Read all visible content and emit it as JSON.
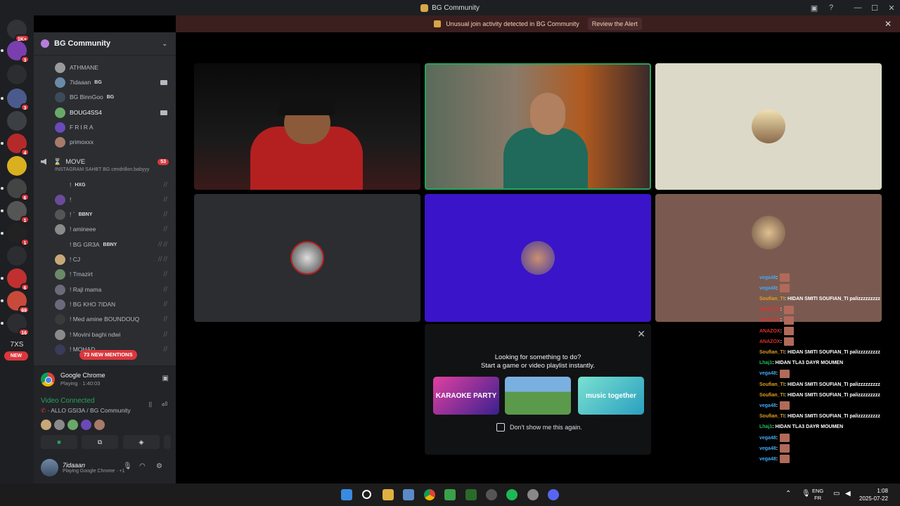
{
  "window": {
    "title": "BG Community",
    "controls": [
      "—",
      "☐",
      "✕"
    ]
  },
  "alert": {
    "message": "Unusual join activity detected in BG Community",
    "button": "Review the Alert",
    "close": "✕"
  },
  "rail": {
    "home_badge": "1K+",
    "badges": [
      "3",
      "3",
      "4",
      "6",
      "1",
      "1",
      "6",
      "69",
      "16"
    ],
    "text_7xs": "7XS",
    "new_pill": "NEW"
  },
  "sidebar": {
    "server_name": "BG Community",
    "users_top": [
      {
        "name": "ATHMANE",
        "tag": ""
      },
      {
        "name": "7idaaan",
        "tag": "BG"
      },
      {
        "name": "BG BinnGoo",
        "tag": "BG"
      },
      {
        "name": "BOUG4SS4",
        "tag": ""
      },
      {
        "name": "FRIRA",
        "tag": ""
      },
      {
        "name": "primoxxx",
        "tag": ""
      }
    ],
    "channel": {
      "name": "MOVE",
      "count": "53",
      "subtitle": "INSTAGRAM SAHBT BG cendrillon.babyyy"
    },
    "users_move": [
      {
        "name": "!",
        "tag": "HXG"
      },
      {
        "name": "!",
        "tag": ""
      },
      {
        "name": "! `",
        "tag": "BBNY"
      },
      {
        "name": "! amineee",
        "tag": ""
      },
      {
        "name": "! BG GR3A",
        "tag": "BBNY"
      },
      {
        "name": "! CJ",
        "tag": ""
      },
      {
        "name": "! Tmazirt",
        "tag": ""
      },
      {
        "name": "! Rajl mama",
        "tag": ""
      },
      {
        "name": "! BG KHO 7IDAN",
        "tag": ""
      },
      {
        "name": "! Med amine BOUNDOUQ",
        "tag": ""
      },
      {
        "name": "! Movini baghi ndwi",
        "tag": ""
      },
      {
        "name": "! MOHAD",
        "tag": ""
      }
    ],
    "mentions_pill": "73 NEW MENTIONS"
  },
  "panel": {
    "activity_name": "Google Chrome",
    "activity_status": "Playing · 1:40:03",
    "voice_status": "Video Connected",
    "voice_channel": "ALLO GSI3A / BG Community",
    "user_name": "7idaaan",
    "user_status": "Playing Google Chrome · +1"
  },
  "picker": {
    "line1": "Looking for something to do?",
    "line2": "Start a game or video playlist instantly.",
    "cards": [
      "KARAOKE PARTY",
      "",
      "music together"
    ],
    "checkbox_label": "Don't show me this again."
  },
  "chat": [
    {
      "user": "vega48",
      "text": ":",
      "color": "#3fa9f5",
      "emote": true
    },
    {
      "user": "vega48",
      "text": ":",
      "color": "#3fa9f5",
      "emote": true
    },
    {
      "user": "Soufian_TI",
      "text": ": HIDAN SMITI SOUFIAN_TI palizzzzzzzzz",
      "color": "#e0a020",
      "emote": false
    },
    {
      "user": "ANAZOX",
      "text": ":",
      "color": "#e03030",
      "emote": true
    },
    {
      "user": "ANAZOX",
      "text": ":",
      "color": "#e03030",
      "emote": true
    },
    {
      "user": "ANAZOX",
      "text": ":",
      "color": "#e03030",
      "emote": true
    },
    {
      "user": "ANAZOX",
      "text": ":",
      "color": "#e03030",
      "emote": true
    },
    {
      "user": "Soufian_TI",
      "text": ": HIDAN SMITI SOUFIAN_TI palizzzzzzzzz",
      "color": "#e0a020",
      "emote": false
    },
    {
      "user": "Lhaj1",
      "text": ": HIDAN TLA3 DAYR MOUMEN",
      "color": "#20c060",
      "emote": false
    },
    {
      "user": "vega48",
      "text": ":",
      "color": "#3fa9f5",
      "emote": true
    },
    {
      "user": "Soufian_TI",
      "text": ": HIDAN SMITI SOUFIAN_TI palizzzzzzzzz",
      "color": "#e0a020",
      "emote": false
    },
    {
      "user": "Soufian_TI",
      "text": ": HIDAN SMITI SOUFIAN_TI palizzzzzzzzz",
      "color": "#e0a020",
      "emote": false
    },
    {
      "user": "vega48",
      "text": ":",
      "color": "#3fa9f5",
      "emote": true
    },
    {
      "user": "Soufian_TI",
      "text": ": HIDAN SMITI SOUFIAN_TI palizzzzzzzzz",
      "color": "#e0a020",
      "emote": false
    },
    {
      "user": "Lhaj1",
      "text": ": HIDAN TLA3 DAYR MOUMEN",
      "color": "#20c060",
      "emote": false
    },
    {
      "user": "vega48",
      "text": ":",
      "color": "#3fa9f5",
      "emote": true
    },
    {
      "user": "vega48",
      "text": ":",
      "color": "#3fa9f5",
      "emote": true
    },
    {
      "user": "vega48",
      "text": ":",
      "color": "#3fa9f5",
      "emote": true
    }
  ],
  "taskbar": {
    "lang1": "ENG",
    "lang2": "FR",
    "time": "1:08",
    "date": "2025-07-22"
  }
}
